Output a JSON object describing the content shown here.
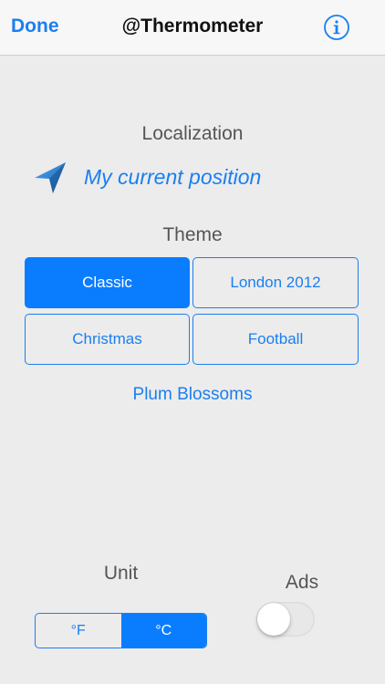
{
  "nav": {
    "done_label": "Done",
    "title": "@Thermometer"
  },
  "localization": {
    "label": "Localization",
    "position_text": "My current position"
  },
  "theme": {
    "label": "Theme",
    "options": [
      {
        "label": "Classic",
        "selected": true
      },
      {
        "label": "London 2012",
        "selected": false
      },
      {
        "label": "Christmas",
        "selected": false
      },
      {
        "label": "Football",
        "selected": false
      }
    ],
    "extra_option": "Plum Blossoms"
  },
  "unit": {
    "label": "Unit",
    "options": [
      "°F",
      "°C"
    ],
    "selected": "°C"
  },
  "ads": {
    "label": "Ads",
    "enabled": false
  },
  "colors": {
    "accent": "#1a7ff0",
    "selected_fill": "#0a7dff",
    "background": "#ececec"
  },
  "icons": {
    "info": "info-circle-icon",
    "location": "location-arrow-icon"
  }
}
